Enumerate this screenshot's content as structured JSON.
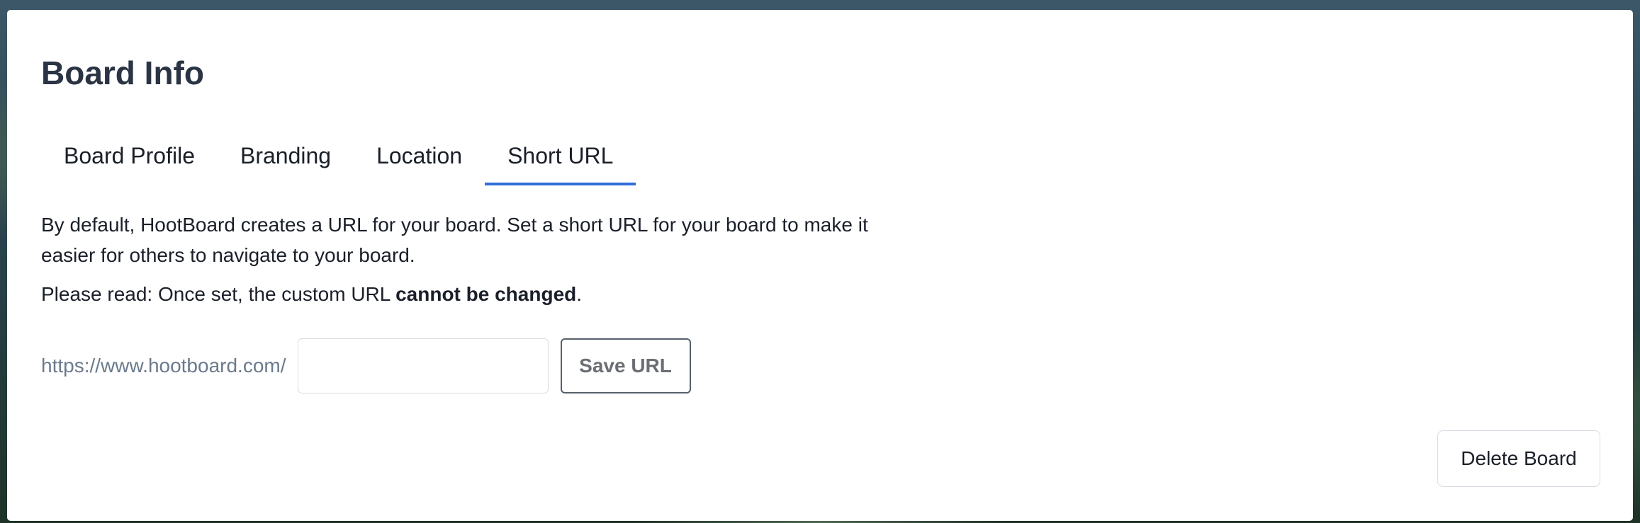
{
  "page": {
    "title": "Board Info"
  },
  "tabs": [
    {
      "label": "Board Profile",
      "active": false
    },
    {
      "label": "Branding",
      "active": false
    },
    {
      "label": "Location",
      "active": false
    },
    {
      "label": "Short URL",
      "active": true
    }
  ],
  "short_url": {
    "description": "By default, HootBoard creates a URL for your board. Set a short URL for your board to make it easier for others to navigate to your board.",
    "warning_prefix": "Please read: Once set, the custom URL ",
    "warning_bold": "cannot be changed",
    "warning_suffix": ".",
    "url_prefix": "https://www.hootboard.com/",
    "input_value": "",
    "input_placeholder": "",
    "save_label": "Save URL"
  },
  "actions": {
    "delete_label": "Delete Board"
  },
  "colors": {
    "accent": "#2d6fd9",
    "text": "#1a1f29",
    "muted": "#6b7a8c"
  }
}
